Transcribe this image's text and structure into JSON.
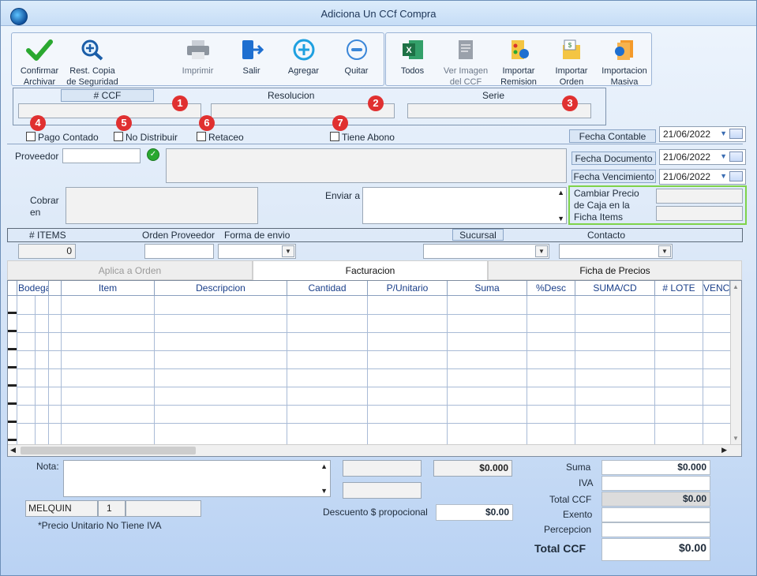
{
  "window": {
    "title": "Adiciona Un CCf Compra"
  },
  "toolbar": {
    "confirmar": [
      "Confirmar",
      "Archivar"
    ],
    "rest_copia": [
      "Rest. Copia",
      "de Seguridad"
    ],
    "imprimir": "Imprimir",
    "salir": "Salir",
    "agregar": "Agregar",
    "quitar": "Quitar",
    "todos": "Todos",
    "ver_imagen": [
      "Ver Imagen",
      "del CCF"
    ],
    "importar_remision": [
      "Importar",
      "Remision"
    ],
    "importar_orden": [
      "Importar",
      "Orden"
    ],
    "importacion_masiva": [
      "Importacion",
      "Masiva"
    ]
  },
  "header": {
    "ccf_label": "# CCF",
    "resolucion_label": "Resolucion",
    "serie_label": "Serie",
    "badges": [
      "1",
      "2",
      "3",
      "4",
      "5",
      "6",
      "7"
    ]
  },
  "checks": {
    "pago_contado": "Pago Contado",
    "no_distribuir": "No Distribuir",
    "retaceo": "Retaceo",
    "tiene_abono": "Tiene Abono"
  },
  "dates": {
    "fecha_contable_label": "Fecha Contable",
    "fecha_contable": "21/06/2022",
    "fecha_documento_label": "Fecha Documento",
    "fecha_documento": "21/06/2022",
    "fecha_vencimiento_label": "Fecha Vencimiento",
    "fecha_vencimiento": "21/06/2022"
  },
  "form": {
    "proveedor_label": "Proveedor",
    "cobrar_en_label": [
      "Cobrar",
      "en"
    ],
    "enviar_a_label": "Enviar a",
    "cambiar_precio_label": [
      "Cambiar Precio",
      "de Caja en la",
      "Ficha Items"
    ]
  },
  "row2": {
    "items_label": "# ITEMS",
    "items_value": "0",
    "orden_proveedor_label": "Orden Proveedor",
    "forma_envio_label": "Forma de envio",
    "sucursal_label": "Sucursal",
    "contacto_label": "Contacto"
  },
  "tabs": [
    "Aplica a Orden",
    "Facturacion",
    "Ficha de Precios"
  ],
  "grid": {
    "columns": [
      "Bodega",
      "Item",
      "Descripcion",
      "Cantidad",
      "P/Unitario",
      "Suma",
      "%Desc",
      "SUMA/CD",
      "# LOTE",
      "VENC"
    ]
  },
  "footer": {
    "nota_label": "Nota:",
    "amount_top": "$0.000",
    "descuento_label": "Descuento $ propocional",
    "descuento_value": "$0.00",
    "user": "MELQUIN",
    "user_num": "1",
    "note_iva": "*Precio Unitario No Tiene IVA"
  },
  "totals": {
    "suma_label": "Suma",
    "suma_value": "$0.000",
    "iva_label": "IVA",
    "total_ccf_label": "Total CCF",
    "total_ccf_value": "$0.00",
    "exento_label": "Exento",
    "percepcion_label": "Percepcion",
    "grand_label": "Total CCF",
    "grand_value": "$0.00"
  }
}
